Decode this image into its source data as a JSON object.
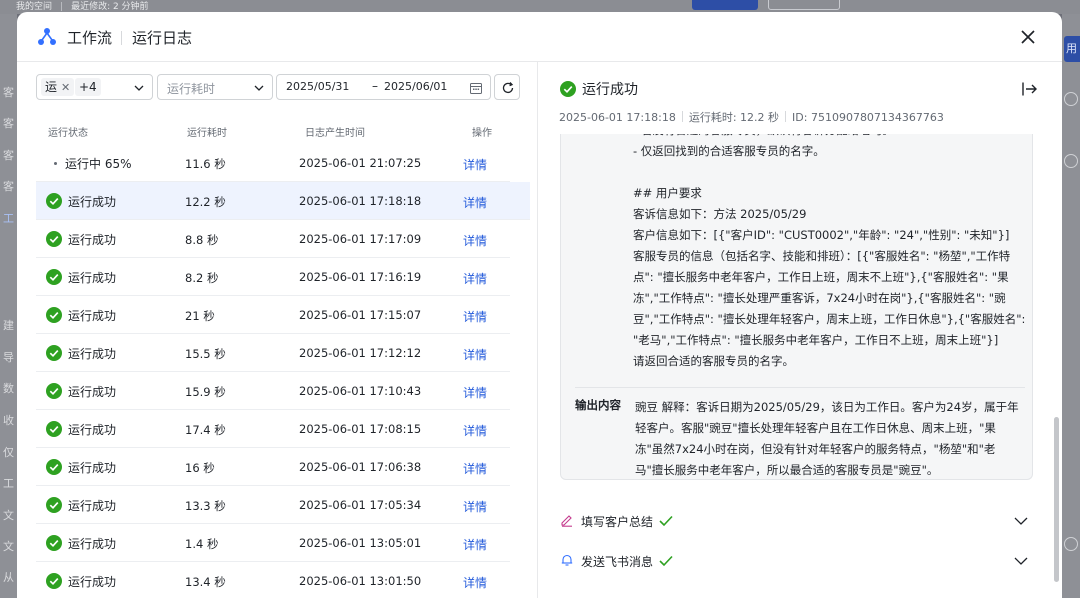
{
  "background": {
    "breadcrumb": "我的空间",
    "last_modified": "最近修改: 2 分钟前",
    "left_glyphs": [
      "客",
      "客",
      "客",
      "客",
      "工",
      "建",
      "导",
      "数",
      "收",
      "仅",
      "工",
      "文",
      "文",
      "从"
    ],
    "right_tag": "用"
  },
  "modal": {
    "title": "工作流",
    "subtitle": "运行日志"
  },
  "filters": {
    "status_chip": "运",
    "status_more": "+4",
    "duration_placeholder": "运行耗时",
    "date_start": "2025/05/31",
    "date_sep": "–",
    "date_end": "2025/06/01"
  },
  "table": {
    "headers": {
      "status": "运行状态",
      "duration": "运行耗时",
      "time": "日志产生时间",
      "action": "操作"
    },
    "rows": [
      {
        "status": "运行中 65%",
        "running": true,
        "duration": "11.6 秒",
        "time": "2025-06-01 21:07:25",
        "action": "详情"
      },
      {
        "status": "运行成功",
        "running": false,
        "duration": "12.2 秒",
        "time": "2025-06-01 17:18:18",
        "action": "详情",
        "selected": true
      },
      {
        "status": "运行成功",
        "running": false,
        "duration": "8.8 秒",
        "time": "2025-06-01 17:17:09",
        "action": "详情"
      },
      {
        "status": "运行成功",
        "running": false,
        "duration": "8.2 秒",
        "time": "2025-06-01 17:16:19",
        "action": "详情"
      },
      {
        "status": "运行成功",
        "running": false,
        "duration": "21 秒",
        "time": "2025-06-01 17:15:07",
        "action": "详情"
      },
      {
        "status": "运行成功",
        "running": false,
        "duration": "15.5 秒",
        "time": "2025-06-01 17:12:12",
        "action": "详情"
      },
      {
        "status": "运行成功",
        "running": false,
        "duration": "15.9 秒",
        "time": "2025-06-01 17:10:43",
        "action": "详情"
      },
      {
        "status": "运行成功",
        "running": false,
        "duration": "17.4 秒",
        "time": "2025-06-01 17:08:15",
        "action": "详情"
      },
      {
        "status": "运行成功",
        "running": false,
        "duration": "16 秒",
        "time": "2025-06-01 17:06:38",
        "action": "详情"
      },
      {
        "status": "运行成功",
        "running": false,
        "duration": "13.3 秒",
        "time": "2025-06-01 17:05:34",
        "action": "详情"
      },
      {
        "status": "运行成功",
        "running": false,
        "duration": "1.4 秒",
        "time": "2025-06-01 13:05:01",
        "action": "详情"
      },
      {
        "status": "运行成功",
        "running": false,
        "duration": "13.4 秒",
        "time": "2025-06-01 13:01:50",
        "action": "详情"
      }
    ]
  },
  "detail": {
    "status": "运行成功",
    "timestamp": "2025-06-01 17:18:18",
    "duration": "运行耗时: 12.2 秒",
    "id": "ID: 7510907807134367763",
    "input_lines": [
      "- 若没有合适的客服专员，默认将客诉分配给老马。",
      "- 仅返回找到的合适客服专员的名字。",
      "",
      "## 用户要求",
      "客诉信息如下：方法 2025/05/29",
      "客户信息如下：[{\"客户ID\": \"CUST0002\",\"年龄\": \"24\",\"性别\": \"未知\"}]",
      "客服专员的信息（包括名字、技能和排班）：[{\"客服姓名\": \"杨堃\",\"工作特点\": \"擅长服务中老年客户，工作日上班，周末不上班\"},{\"客服姓名\": \"果冻\",\"工作特点\": \"擅长处理严重客诉，7x24小时在岗\"},{\"客服姓名\": \"豌豆\",\"工作特点\": \"擅长处理年轻客户，周末上班，工作日休息\"},{\"客服姓名\": \"老马\",\"工作特点\": \"擅长服务中老年客户，工作日不上班，周末上班\"}]",
      "请返回合适的客服专员的名字。"
    ],
    "output_label": "输出内容",
    "output_text": "豌豆 解释：客诉日期为2025/05/29，该日为工作日。客户为24岁，属于年轻客户。客服\"豌豆\"擅长处理年轻客户且在工作日休息、周末上班，\"果冻\"虽然7x24小时在岗，但没有针对年轻客户的服务特点，\"杨堃\"和\"老马\"擅长服务中老年客户，所以最合适的客服专员是\"豌豆\"。"
  },
  "nodes": [
    {
      "label": "填写客户总结",
      "icon": "pencil-icon"
    },
    {
      "label": "发送飞书消息",
      "icon": "bell-icon"
    }
  ],
  "colors": {
    "success": "#2ea121",
    "link": "#245bdb",
    "selected_row": "#eef3fe"
  }
}
